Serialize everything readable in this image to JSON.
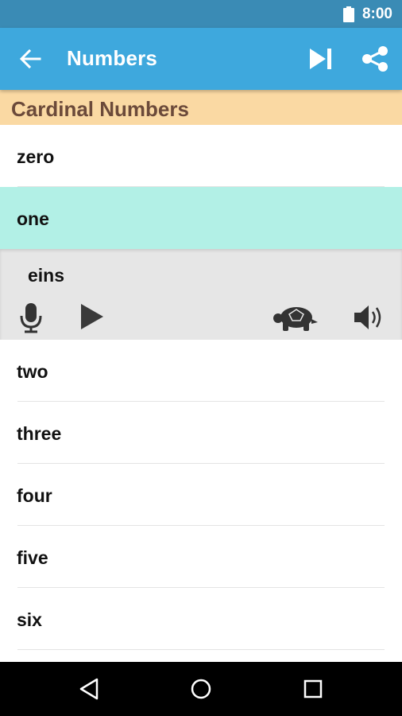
{
  "status_bar": {
    "time": "8:00",
    "icons": [
      "battery-icon"
    ]
  },
  "app_bar": {
    "title": "Numbers",
    "icons": [
      "back-arrow-icon",
      "skip-next-icon",
      "share-icon"
    ],
    "color": "#3ea8dd"
  },
  "section": {
    "title": "Cardinal Numbers",
    "color": "#fad9a3",
    "text_color": "#6b4a3a"
  },
  "list": {
    "items_before": [
      {
        "label": "zero"
      }
    ],
    "selected": {
      "label": "one",
      "translation": "eins",
      "highlight_color": "#b2f0e6",
      "controls": [
        "microphone-icon",
        "play-icon",
        "turtle-slow-icon",
        "speaker-icon"
      ]
    },
    "items_after": [
      {
        "label": "two"
      },
      {
        "label": "three"
      },
      {
        "label": "four"
      },
      {
        "label": "five"
      },
      {
        "label": "six"
      }
    ]
  },
  "nav_bar": {
    "icons": [
      "nav-back-icon",
      "nav-home-icon",
      "nav-recents-icon"
    ]
  }
}
